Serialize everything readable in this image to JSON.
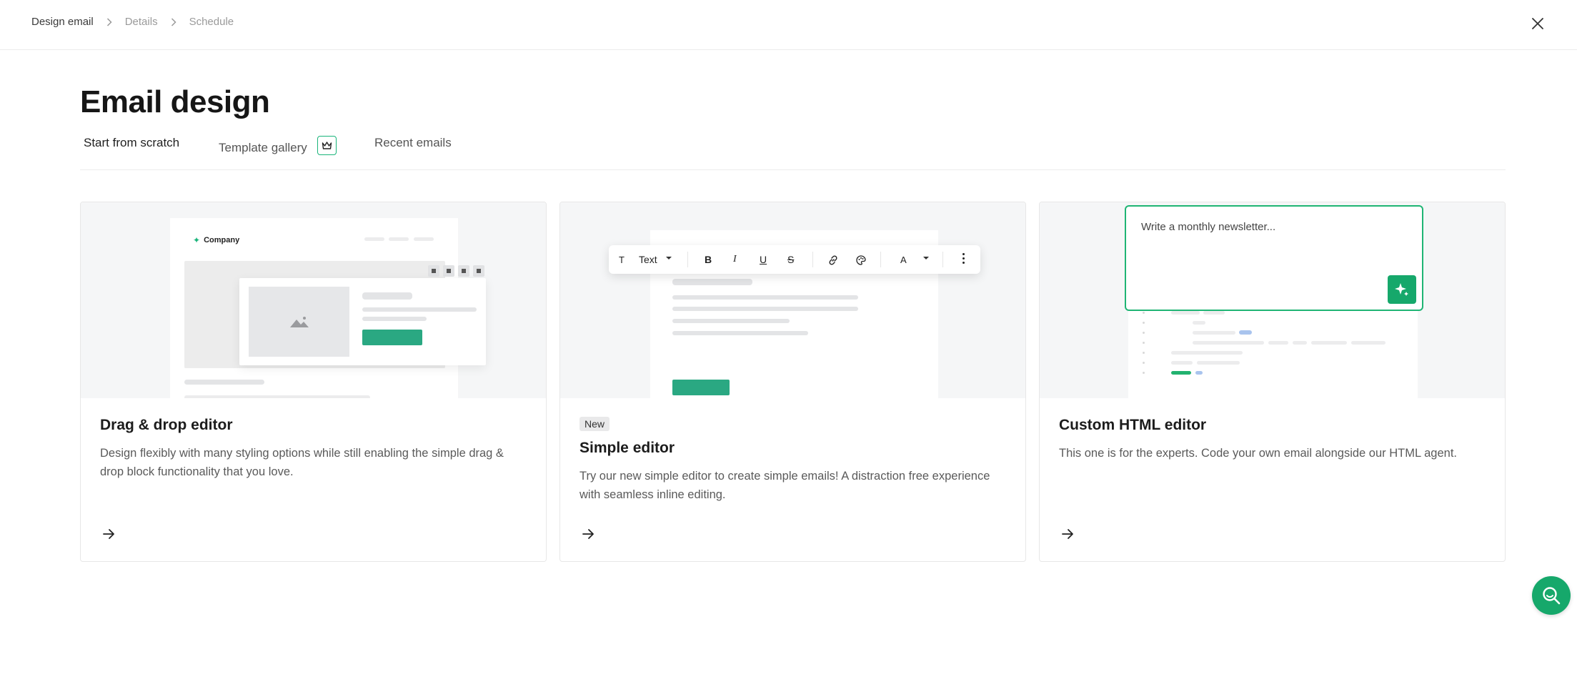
{
  "breadcrumb": {
    "items": [
      "Design email",
      "Details",
      "Schedule"
    ]
  },
  "page": {
    "title": "Email design"
  },
  "tabs": [
    {
      "label": "Start from scratch",
      "active": true
    },
    {
      "label": "Template gallery",
      "active": false,
      "icon": "crown-icon"
    },
    {
      "label": "Recent emails",
      "active": false
    }
  ],
  "cards": [
    {
      "title": "Drag & drop editor",
      "description": "Design flexibly with many styling options while still enabling the simple drag & drop block functionality that you love.",
      "preview": {
        "company_name": "Company"
      }
    },
    {
      "badge": "New",
      "title": "Simple editor",
      "description": "Try our new simple editor to create simple emails! A distraction free experience with seamless inline editing.",
      "preview": {
        "text_style_label": "Text",
        "color_button_label": "A"
      }
    },
    {
      "title": "Custom HTML editor",
      "description": "This one is for the experts. Code your own email alongside our HTML agent.",
      "preview": {
        "prompt_placeholder": "Write a monthly newsletter..."
      }
    }
  ],
  "colors": {
    "accent": "#16a86b",
    "button_green": "#2aa882",
    "border": "#e7e7e7"
  }
}
